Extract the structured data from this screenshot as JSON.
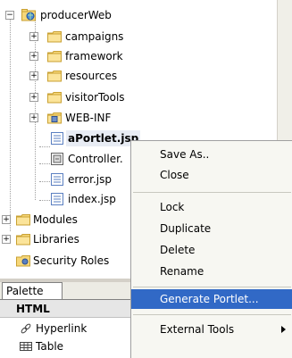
{
  "tree": {
    "items": [
      {
        "label": "producerWeb",
        "icon": "web-project-icon",
        "expander": "−"
      },
      {
        "label": "campaigns",
        "icon": "folder-icon",
        "expander": "+"
      },
      {
        "label": "framework",
        "icon": "folder-icon",
        "expander": "+"
      },
      {
        "label": "resources",
        "icon": "folder-icon",
        "expander": "+"
      },
      {
        "label": "visitorTools",
        "icon": "folder-icon",
        "expander": "+"
      },
      {
        "label": "WEB-INF",
        "icon": "web-inf-folder-icon",
        "expander": "+"
      },
      {
        "label": "aPortlet.jsp",
        "icon": "jsp-file-icon"
      },
      {
        "label": "Controller.",
        "icon": "controller-file-icon"
      },
      {
        "label": "error.jsp",
        "icon": "jsp-file-icon"
      },
      {
        "label": "index.jsp",
        "icon": "jsp-file-icon"
      },
      {
        "label": "Modules",
        "icon": "folder-icon",
        "expander": "+"
      },
      {
        "label": "Libraries",
        "icon": "folder-icon",
        "expander": "+"
      },
      {
        "label": "Security Roles",
        "icon": "security-roles-icon"
      }
    ]
  },
  "palette": {
    "tab_label": "Palette",
    "section_label": "HTML",
    "section_expander": "−",
    "items": [
      {
        "label": "Hyperlink",
        "icon": "hyperlink-icon"
      },
      {
        "label": "Table",
        "icon": "table-icon"
      }
    ]
  },
  "context_menu": {
    "items": [
      {
        "label": "Save As..",
        "mnemonic": "a"
      },
      {
        "label": "Close",
        "mnemonic": "C"
      },
      {
        "label": "Lock",
        "mnemonic": "L"
      },
      {
        "label": "Duplicate",
        "mnemonic": "u"
      },
      {
        "label": "Delete",
        "mnemonic": "t"
      },
      {
        "label": "Rename",
        "mnemonic": "R"
      },
      {
        "label": "Generate Portlet...",
        "highlighted": true
      },
      {
        "label": "External Tools",
        "mnemonic": "x",
        "submenu": true
      }
    ]
  },
  "colors": {
    "menu_highlight": "#3169c6",
    "folder": "#f6d779",
    "folder_dark": "#c9a133",
    "jsp_blue": "#5a7fc1",
    "background": "#ffffff"
  }
}
